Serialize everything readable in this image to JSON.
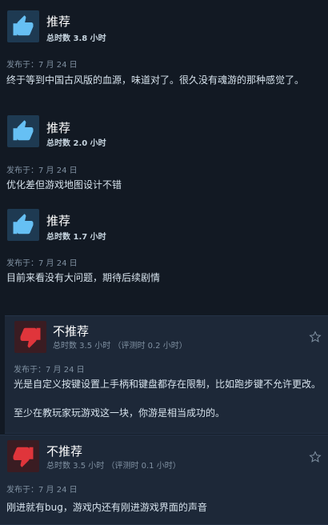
{
  "reviews": [
    {
      "verdict": "推荐",
      "hours": "总时数 3.8 小时",
      "posted": "发布于：7 月 24 日",
      "text": "终于等到中国古风版的血源，味道对了。很久没有魂游的那种感觉了。"
    },
    {
      "verdict": "推荐",
      "hours": "总时数 2.0 小时",
      "posted": "发布于：7 月 24 日",
      "text": "优化差但游戏地图设计不错"
    },
    {
      "verdict": "推荐",
      "hours": "总时数 1.7 小时",
      "posted": "发布于：7 月 24 日",
      "text": "目前来看没有大问题，期待后续剧情"
    },
    {
      "verdict": "不推荐",
      "hours": "总时数 3.5 小时  （评测时 0.2 小时）",
      "posted": "发布于：7 月 24 日",
      "text": "光是自定义按键设置上手柄和键盘都存在限制，比如跑步键不允许更改。",
      "text2": "至少在教玩家玩游戏这一块，你游是相当成功的。"
    },
    {
      "verdict": "不推荐",
      "hours": "总时数 3.5 小时  （评测时 0.1 小时）",
      "posted": "发布于：7 月 24 日",
      "text": "刚进就有bug，游戏内还有刚进游戏界面的声音"
    }
  ],
  "colors": {
    "background": "#121923",
    "negative_bg": "#1d2838",
    "thumb_up": "#66c0f4",
    "thumb_down": "#e0353b"
  },
  "icons": [
    "thumbs-up-icon",
    "thumbs-down-icon",
    "star-icon"
  ]
}
